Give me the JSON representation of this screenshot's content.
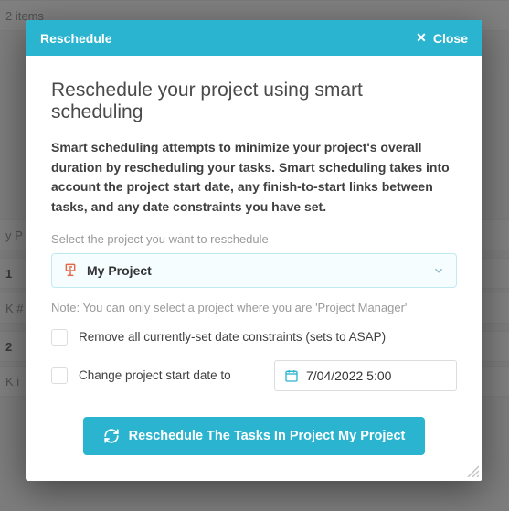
{
  "backdrop": {
    "items_count": "2 items",
    "row_prefix": "y P",
    "row1": "1",
    "row2": "2",
    "rowk1": "K #",
    "rowk2": "K i"
  },
  "modal": {
    "header_title": "Reschedule",
    "close_label": "Close",
    "title": "Reschedule your project using smart scheduling",
    "description": "Smart scheduling attempts to minimize your project's overall duration by rescheduling your tasks. Smart scheduling takes into account the project start date, any finish-to-start links between tasks, and any date constraints you have set.",
    "select_label": "Select the project you want to reschedule",
    "selected_project": "My Project",
    "note": "Note: You can only select a project where you are 'Project Manager'",
    "checkbox1_label": "Remove all currently-set date constraints (sets to ASAP)",
    "checkbox2_label": "Change project start date to",
    "date_value": "7/04/2022 5:00",
    "button_label": "Reschedule The Tasks In Project My Project"
  }
}
